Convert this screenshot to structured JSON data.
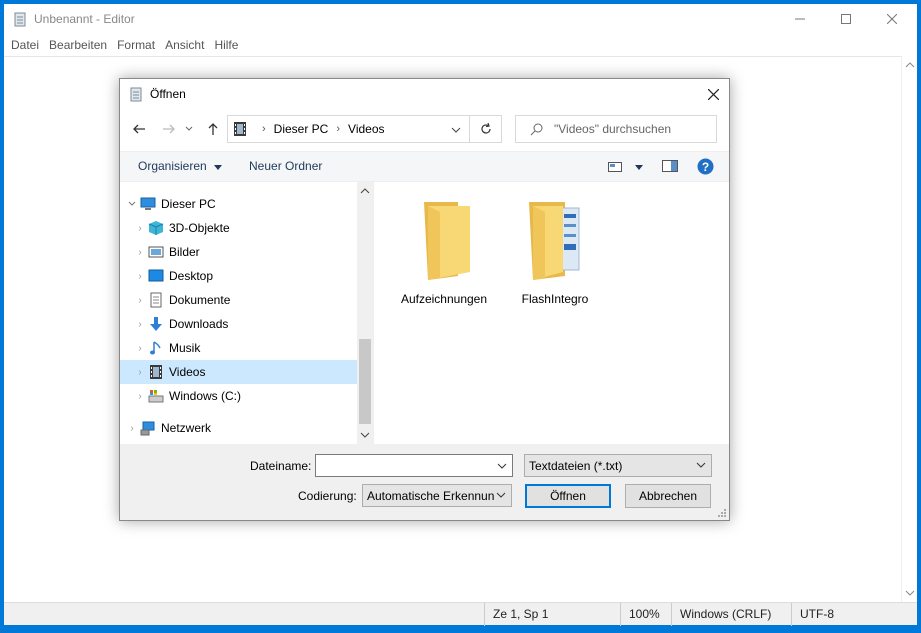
{
  "editor": {
    "title": "Unbenannt - Editor",
    "menu": [
      "Datei",
      "Bearbeiten",
      "Format",
      "Ansicht",
      "Hilfe"
    ],
    "status": {
      "position": "Ze 1, Sp 1",
      "zoom": "100%",
      "line_ending": "Windows (CRLF)",
      "encoding": "UTF-8"
    }
  },
  "dialog": {
    "title": "Öffnen",
    "breadcrumb": [
      "Dieser PC",
      "Videos"
    ],
    "search_placeholder": "\"Videos\" durchsuchen",
    "toolbar": {
      "organize": "Organisieren",
      "new_folder": "Neuer Ordner"
    },
    "tree": [
      {
        "label": "Dieser PC",
        "icon": "pc-icon"
      },
      {
        "label": "3D-Objekte",
        "icon": "cube-icon"
      },
      {
        "label": "Bilder",
        "icon": "pictures-icon"
      },
      {
        "label": "Desktop",
        "icon": "desktop-icon"
      },
      {
        "label": "Dokumente",
        "icon": "documents-icon"
      },
      {
        "label": "Downloads",
        "icon": "download-icon"
      },
      {
        "label": "Musik",
        "icon": "music-icon"
      },
      {
        "label": "Videos",
        "icon": "video-icon"
      },
      {
        "label": "Windows (C:)",
        "icon": "drive-icon"
      },
      {
        "label": "Netzwerk",
        "icon": "network-icon"
      }
    ],
    "files": [
      {
        "name": "Aufzeichnungen",
        "icon": "folder-icon"
      },
      {
        "name": "FlashIntegro",
        "icon": "folder-icon"
      }
    ],
    "filename_label": "Dateiname:",
    "filename_value": "",
    "filetype": "Textdateien (*.txt)",
    "encoding_label": "Codierung:",
    "encoding_value": "Automatische Erkennun",
    "open_button": "Öffnen",
    "cancel_button": "Abbrechen"
  },
  "colors": {
    "desktop": "#0078d7",
    "selection": "#cce8ff",
    "folder": "#f8d775",
    "accent": "#0078d7"
  }
}
